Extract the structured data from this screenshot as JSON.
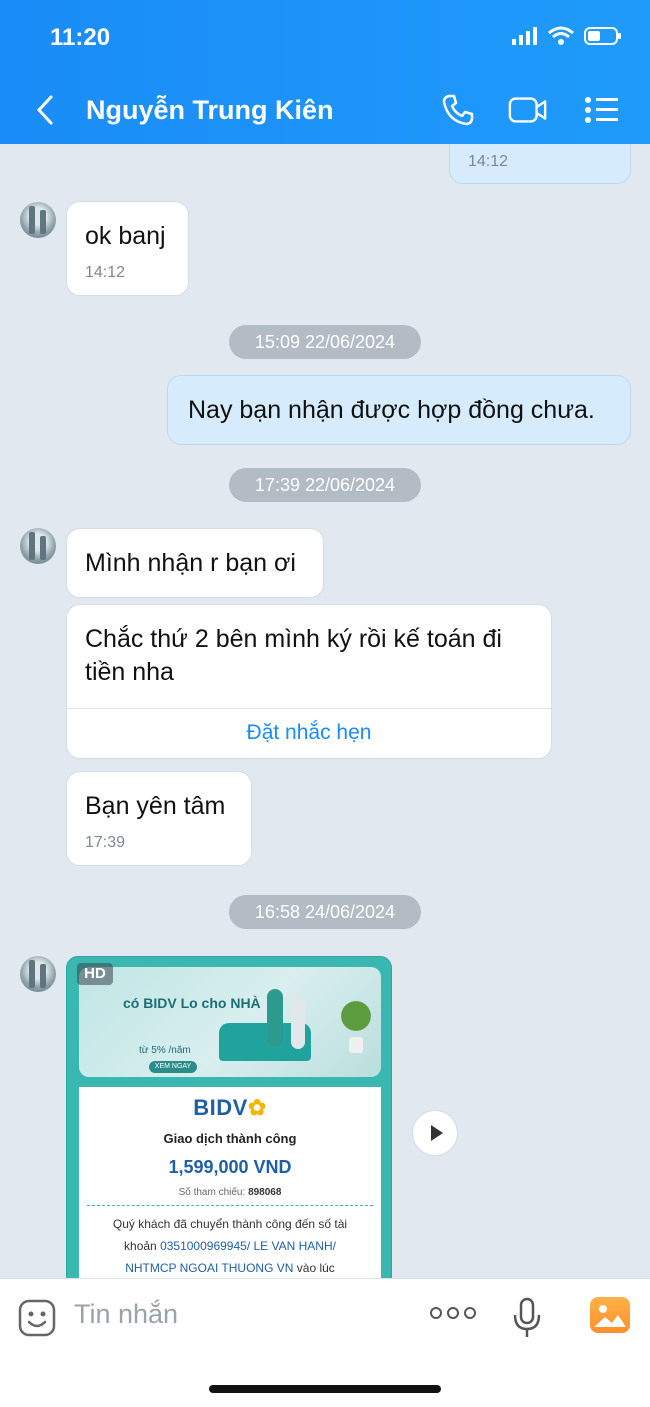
{
  "status_bar": {
    "time": "11:20"
  },
  "header": {
    "title": "Nguyễn Trung Kiên"
  },
  "messages": {
    "m0": {
      "time": "14:12"
    },
    "m1": {
      "text": "ok banj",
      "time": "14:12"
    },
    "d1": "15:09 22/06/2024",
    "m2": {
      "text": "Nay bạn nhận được hợp đồng chưa."
    },
    "d2": "17:39 22/06/2024",
    "m3": {
      "text": "Mình nhận r bạn ơi"
    },
    "m4": {
      "text": "Chắc thứ 2 bên mình ký rồi kế toán đi tiền nha",
      "action": "Đặt nhắc hẹn"
    },
    "m5": {
      "text": "Bạn yên tâm",
      "time": "17:39"
    },
    "d3": "16:58 24/06/2024"
  },
  "receipt": {
    "hd_badge": "HD",
    "banner_title": "có BIDV Lo cho NHÀ",
    "banner_rate": "từ 5% /năm",
    "banner_button": "XEM NGAY",
    "bank_logo": "BIDV",
    "status": "Giao dịch thành công",
    "amount": "1,599,000 VND",
    "ref_label": "Số tham chiếu:",
    "ref_value": "898068",
    "body_line1": "Quý khách đã chuyển thành công đến số tài",
    "body_line2_prefix": "khoản",
    "body_account": "0351000969945/ LE VAN HANH/",
    "body_bank": "NHTMCP NGOAI THUONG VN",
    "body_suffix": "vào lúc"
  },
  "composer": {
    "placeholder": "Tin nhắn"
  },
  "colors": {
    "header_blue": "#1a8cf7",
    "my_bubble": "#d6ecfd",
    "chat_bg": "#e2e8f0",
    "link_blue": "#1a8cf7"
  }
}
